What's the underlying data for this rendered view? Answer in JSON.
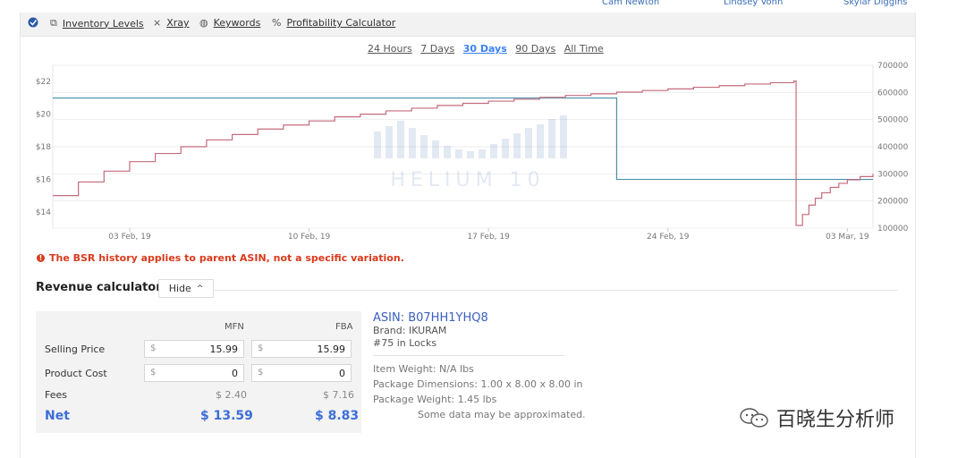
{
  "top_names": [
    "Cam Newton",
    "Lindsey Vonn",
    "Skylar Diggins"
  ],
  "toolbar": {
    "items": [
      {
        "label": "Inventory Levels",
        "icon": "copy-icon"
      },
      {
        "label": "Xray",
        "icon": "xray-icon"
      },
      {
        "label": "Keywords",
        "icon": "keywords-icon"
      },
      {
        "label": "Profitability Calculator",
        "icon": "percent-icon"
      }
    ]
  },
  "time_ranges": {
    "options": [
      "24 Hours",
      "7 Days",
      "30 Days",
      "90 Days",
      "All Time"
    ],
    "active": "30 Days"
  },
  "chart_data": {
    "type": "line",
    "x_range": [
      "2019-01-31",
      "2019-03-04"
    ],
    "x_ticks": [
      "03 Feb, 19",
      "10 Feb, 19",
      "17 Feb, 19",
      "24 Feb, 19",
      "03 Mar, 19"
    ],
    "y_left": {
      "range": [
        13,
        23
      ],
      "ticks": [
        "$14",
        "$16",
        "$18",
        "$20",
        "$22"
      ]
    },
    "y_right": {
      "range": [
        100000,
        700000
      ],
      "ticks": [
        "100000",
        "200000",
        "300000",
        "400000",
        "500000",
        "600000",
        "700000"
      ]
    },
    "series": [
      {
        "axis": "left",
        "color": "#4a8fa8",
        "step": true,
        "points": [
          [
            "2019-01-31",
            20.99
          ],
          [
            "2019-02-22",
            20.99
          ],
          [
            "2019-02-22",
            15.99
          ],
          [
            "2019-03-04",
            15.99
          ]
        ]
      },
      {
        "axis": "right",
        "color": "#c46b7c",
        "step": true,
        "points": [
          [
            "2019-01-31",
            220000
          ],
          [
            "2019-02-01",
            270000
          ],
          [
            "2019-02-02",
            310000
          ],
          [
            "2019-02-03",
            345000
          ],
          [
            "2019-02-04",
            375000
          ],
          [
            "2019-02-05",
            400000
          ],
          [
            "2019-02-06",
            425000
          ],
          [
            "2019-02-07",
            445000
          ],
          [
            "2019-02-08",
            465000
          ],
          [
            "2019-02-09",
            480000
          ],
          [
            "2019-02-10",
            495000
          ],
          [
            "2019-02-11",
            510000
          ],
          [
            "2019-02-12",
            520000
          ],
          [
            "2019-02-13",
            532000
          ],
          [
            "2019-02-14",
            542000
          ],
          [
            "2019-02-15",
            552000
          ],
          [
            "2019-02-16",
            560000
          ],
          [
            "2019-02-17",
            568000
          ],
          [
            "2019-02-18",
            575000
          ],
          [
            "2019-02-19",
            582000
          ],
          [
            "2019-02-20",
            589000
          ],
          [
            "2019-02-21",
            595000
          ],
          [
            "2019-02-22",
            601000
          ],
          [
            "2019-02-23",
            607000
          ],
          [
            "2019-02-24",
            613000
          ],
          [
            "2019-02-25",
            619000
          ],
          [
            "2019-02-26",
            625000
          ],
          [
            "2019-02-27",
            631000
          ],
          [
            "2019-02-28",
            636000
          ],
          [
            "2019-02-28T22:00",
            642000
          ],
          [
            "2019-03-01",
            110000
          ],
          [
            "2019-03-01T06:00",
            150000
          ],
          [
            "2019-03-01T12:00",
            185000
          ],
          [
            "2019-03-01T18:00",
            210000
          ],
          [
            "2019-03-02",
            230000
          ],
          [
            "2019-03-02T08:00",
            250000
          ],
          [
            "2019-03-02T16:00",
            265000
          ],
          [
            "2019-03-03",
            278000
          ],
          [
            "2019-03-03T12:00",
            290000
          ],
          [
            "2019-03-04",
            300000
          ]
        ]
      }
    ],
    "grid": true,
    "watermark": "HELIUM 10"
  },
  "warning": "The BSR history applies to parent ASIN, not a specific variation.",
  "revenue_calculator": {
    "title": "Revenue calculator",
    "hide_label": "Hide",
    "col_mfn": "MFN",
    "col_fba": "FBA",
    "currency": "$",
    "rows": {
      "selling_price": {
        "label": "Selling Price",
        "mfn": "15.99",
        "fba": "15.99"
      },
      "product_cost": {
        "label": "Product Cost",
        "mfn": "0",
        "fba": "0"
      },
      "fees": {
        "label": "Fees",
        "mfn": "$ 2.40",
        "fba": "$ 7.16"
      },
      "net": {
        "label": "Net",
        "mfn": "$ 13.59",
        "fba": "$ 8.83"
      }
    }
  },
  "product": {
    "asin": "ASIN: B07HH1YHQ8",
    "brand": "Brand: IKURAM",
    "rank": "#75 in Locks",
    "weight": "Item Weight: N/A lbs",
    "dimensions": "Package Dimensions: 1.00 x 8.00 x 8.00 in",
    "package_weight": "Package Weight: 1.45 lbs",
    "note": "Some data may be approximated."
  },
  "wechat_watermark": "百晓生分析师",
  "colors": {
    "accent": "#3b6ed8",
    "warning": "#d93a1c",
    "price_line": "#4a8fa8",
    "bsr_line": "#c46b7c"
  }
}
